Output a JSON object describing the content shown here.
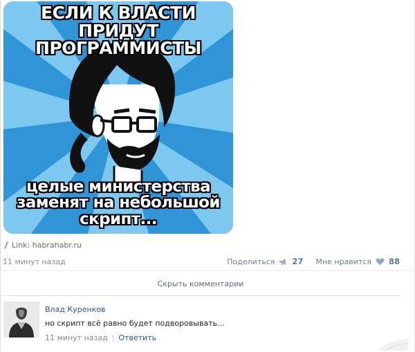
{
  "meme": {
    "top_lines": [
      "ЕСЛИ К ВЛАСТИ ПРИДУТ",
      "ПРОГРАММИСТЫ"
    ],
    "bottom_lines": [
      "целые министерства",
      "заменят на небольшой",
      "скрипт..."
    ],
    "colors": {
      "ray_dark": "#2f95d6",
      "ray_light": "#7cc8f1",
      "outline": "#000000"
    }
  },
  "post": {
    "link_text": "Link: habrahabr.ru",
    "time": "11 минут назад",
    "share_label": "Поделиться",
    "share_count": "27",
    "like_label": "Мне нравится",
    "like_count": "88"
  },
  "comments_toggle": "Скрыть комментарии",
  "comment": {
    "author": "Влад Куренков",
    "text": "но скрипт всё равно будет подворовывать...",
    "time": "11 минут назад",
    "separator": "|",
    "reply_label": "Ответить"
  },
  "icons": {
    "link": "link-icon",
    "share": "megaphone-icon",
    "like": "heart-icon"
  }
}
